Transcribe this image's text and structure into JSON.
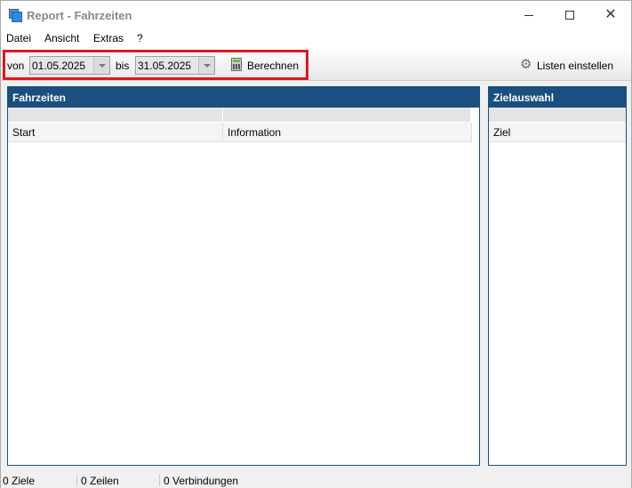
{
  "window": {
    "title": "Report - Fahrzeiten"
  },
  "menu": {
    "items": [
      "Datei",
      "Ansicht",
      "Extras",
      "?"
    ]
  },
  "toolbar": {
    "von_label": "von",
    "von_value": "01.05.2025",
    "bis_label": "bis",
    "bis_value": "31.05.2025",
    "berechnen_label": "Berechnen",
    "listen_label": "Listen einstellen"
  },
  "panels": {
    "fahrzeiten": {
      "title": "Fahrzeiten",
      "columns": [
        "Start",
        "Information"
      ]
    },
    "zielauswahl": {
      "title": "Zielauswahl",
      "columns": [
        "Ziel"
      ]
    }
  },
  "status": {
    "items": [
      "0 Ziele",
      "0 Zeilen",
      "0 Verbindungen"
    ]
  },
  "colors": {
    "panel_header": "#1a4f7f",
    "highlight": "#e0171f"
  },
  "icons": [
    "app-icon",
    "calculator-icon",
    "gear-icon",
    "dropdown-arrow-icon"
  ]
}
